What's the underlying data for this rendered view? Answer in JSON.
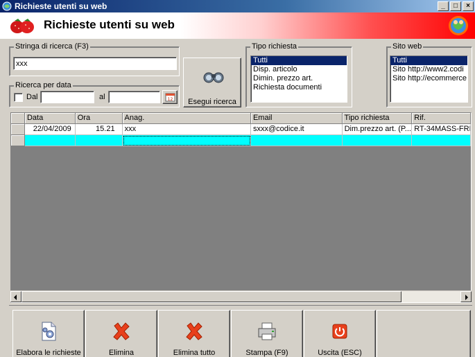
{
  "window": {
    "title": "Richieste utenti su web"
  },
  "banner": {
    "title": "Richieste utenti su web"
  },
  "search": {
    "legend": "Stringa di ricerca (F3)",
    "value": "xxx"
  },
  "date_filter": {
    "legend": "Ricerca per data",
    "from_label": "Dal",
    "to_label": "al",
    "from_value": "",
    "to_value": "",
    "checked": false
  },
  "search_button": {
    "label": "Esegui ricerca"
  },
  "request_type": {
    "legend": "Tipo richiesta",
    "items": [
      "Tutti",
      "Disp. articolo",
      "Dimin. prezzo art.",
      "Richiesta documenti"
    ],
    "selected": 0
  },
  "website": {
    "legend": "Sito web",
    "items": [
      "Tutti",
      "Sito http://www2.codi",
      "Sito http://ecommerce"
    ],
    "selected": 0
  },
  "grid": {
    "columns": [
      "Data",
      "Ora",
      "Anag.",
      "Email",
      "Tipo richiesta",
      "Rif."
    ],
    "rows": [
      [
        "22/04/2009",
        "15.21",
        "xxx",
        "sxxx@codice.it",
        "Dim.prezzo art. (P...",
        "RT-34MASS-FRI"
      ]
    ]
  },
  "toolbar": {
    "process_label": "Elabora le richieste",
    "delete_label": "Elimina",
    "delete_all_label": "Elimina tutto",
    "print_label": "Stampa (F9)",
    "exit_label": "Uscita (ESC)"
  },
  "colors": {
    "titlebar": "#0a246a",
    "selection": "#0a246a",
    "new_row": "#00ffff",
    "banner_accent": "#ff0000"
  }
}
